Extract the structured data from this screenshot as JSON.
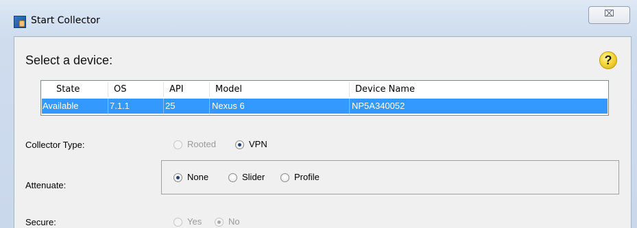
{
  "window": {
    "title": "Start Collector",
    "close_glyph": "⌧"
  },
  "dialog": {
    "heading": "Select a device:",
    "help_glyph": "?"
  },
  "table": {
    "columns": [
      "State",
      "OS",
      "API",
      "Model",
      "Device Name"
    ],
    "rows": [
      [
        "Available",
        "7.1.1",
        "25",
        "Nexus 6",
        "NP5A340052"
      ]
    ]
  },
  "collector_type": {
    "label": "Collector Type:",
    "options": [
      {
        "label": "Rooted",
        "checked": false,
        "enabled": false
      },
      {
        "label": "VPN",
        "checked": true,
        "enabled": true
      }
    ]
  },
  "attenuate": {
    "label": "Attenuate:",
    "options": [
      {
        "label": "None",
        "checked": true,
        "enabled": true
      },
      {
        "label": "Slider",
        "checked": false,
        "enabled": true
      },
      {
        "label": "Profile",
        "checked": false,
        "enabled": true
      }
    ]
  },
  "secure": {
    "label": "Secure:",
    "options": [
      {
        "label": "Yes",
        "checked": false,
        "enabled": false
      },
      {
        "label": "No",
        "checked": true,
        "enabled": false
      }
    ]
  },
  "colors": {
    "selection": "#3399ff",
    "help_icon": "#f5d83a"
  },
  "icons": {
    "app": "collector-app-icon",
    "help": "help-icon",
    "close": "close-icon"
  }
}
